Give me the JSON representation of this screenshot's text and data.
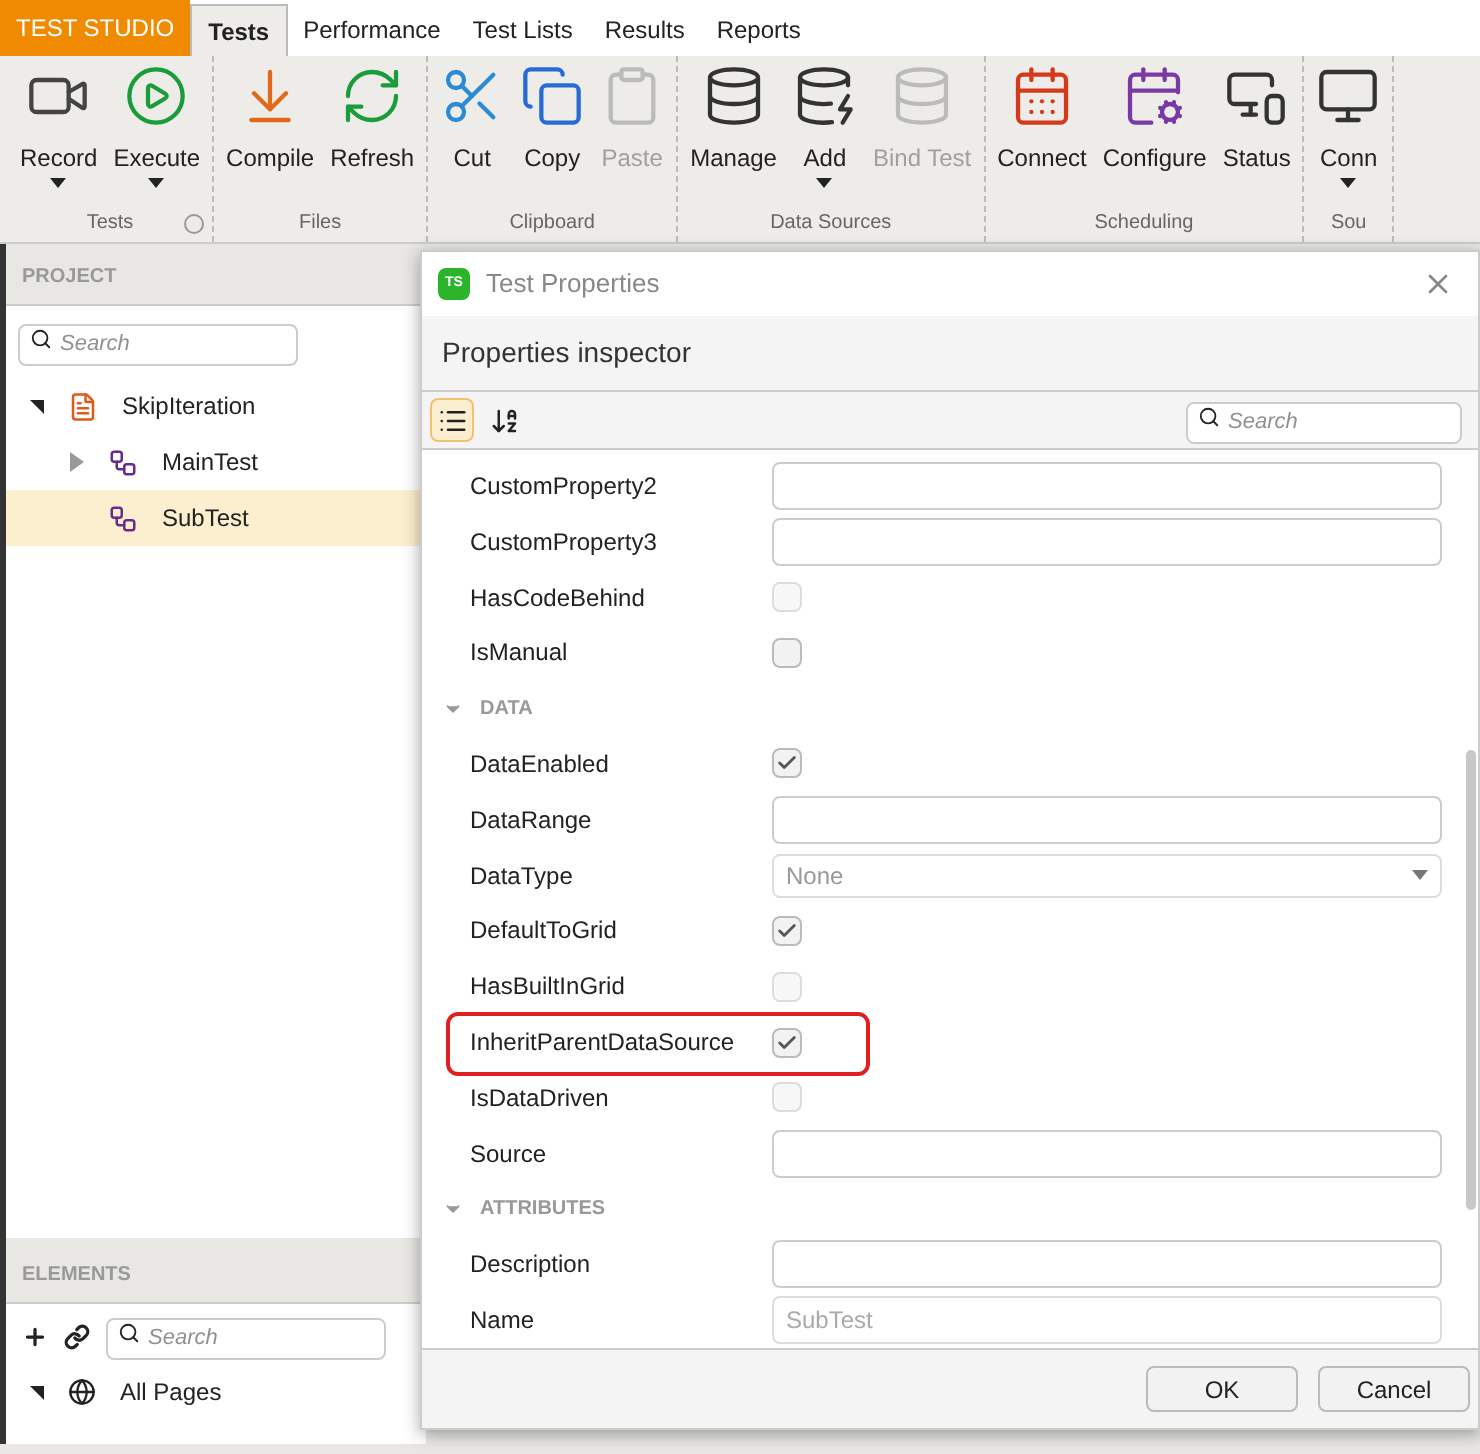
{
  "brand": "TEST STUDIO",
  "app_tabs": [
    {
      "label": "Tests",
      "selected": true
    },
    {
      "label": "Performance",
      "selected": false
    },
    {
      "label": "Test Lists",
      "selected": false
    },
    {
      "label": "Results",
      "selected": false
    },
    {
      "label": "Reports",
      "selected": false
    }
  ],
  "ribbon_groups": [
    {
      "label": "Tests",
      "launcher": true,
      "buttons": [
        {
          "label": "Record",
          "dropdown": true,
          "disabled": false
        },
        {
          "label": "Execute",
          "dropdown": true,
          "disabled": false
        }
      ]
    },
    {
      "label": "Files",
      "launcher": false,
      "buttons": [
        {
          "label": "Compile",
          "dropdown": false,
          "disabled": false
        },
        {
          "label": "Refresh",
          "dropdown": false,
          "disabled": false
        }
      ]
    },
    {
      "label": "Clipboard",
      "launcher": false,
      "buttons": [
        {
          "label": "Cut",
          "dropdown": false,
          "disabled": false
        },
        {
          "label": "Copy",
          "dropdown": false,
          "disabled": false
        },
        {
          "label": "Paste",
          "dropdown": false,
          "disabled": true
        }
      ]
    },
    {
      "label": "Data Sources",
      "launcher": false,
      "buttons": [
        {
          "label": "Manage",
          "dropdown": false,
          "disabled": false
        },
        {
          "label": "Add",
          "dropdown": true,
          "disabled": false
        },
        {
          "label": "Bind Test",
          "dropdown": false,
          "disabled": true
        }
      ]
    },
    {
      "label": "Scheduling",
      "launcher": false,
      "buttons": [
        {
          "label": "Connect",
          "dropdown": false,
          "disabled": false
        },
        {
          "label": "Configure",
          "dropdown": false,
          "disabled": false
        },
        {
          "label": "Status",
          "dropdown": false,
          "disabled": false
        }
      ]
    },
    {
      "label": "Sou",
      "launcher": false,
      "buttons": [
        {
          "label": "Conn",
          "dropdown": true,
          "disabled": false
        }
      ]
    }
  ],
  "project": {
    "title": "PROJECT",
    "search_placeholder": "Search",
    "tree": [
      {
        "label": "SkipIteration",
        "expanded": true,
        "selected": false,
        "children": [
          {
            "label": "MainTest",
            "expanded": false,
            "selected": false
          },
          {
            "label": "SubTest",
            "selected": true
          }
        ]
      }
    ]
  },
  "elements": {
    "title": "ELEMENTS",
    "search_placeholder": "Search",
    "tree": [
      {
        "label": "All Pages",
        "expanded": true
      }
    ]
  },
  "dialog": {
    "title": "Test Properties",
    "logo": "TS",
    "header": "Properties inspector",
    "search_placeholder": "Search",
    "view_buttons": [
      {
        "kind": "categorized",
        "selected": true
      },
      {
        "kind": "alphabetical",
        "selected": false
      }
    ],
    "rows": [
      {
        "kind": "text",
        "label": "CustomProperty2",
        "disabled": false
      },
      {
        "kind": "text",
        "label": "CustomProperty3",
        "disabled": false
      },
      {
        "kind": "checkbox",
        "label": "HasCodeBehind",
        "checked": false,
        "disabled": true,
        "highlighted": false
      },
      {
        "kind": "checkbox",
        "label": "IsManual",
        "checked": false,
        "disabled": false,
        "highlighted": false
      },
      {
        "kind": "header",
        "label": "DATA"
      },
      {
        "kind": "checkbox",
        "label": "DataEnabled",
        "checked": true,
        "disabled": false,
        "highlighted": false
      },
      {
        "kind": "text",
        "label": "DataRange",
        "disabled": false
      },
      {
        "kind": "dropdown",
        "label": "DataType",
        "value": "None",
        "disabled": true
      },
      {
        "kind": "checkbox",
        "label": "DefaultToGrid",
        "checked": true,
        "disabled": false,
        "highlighted": false
      },
      {
        "kind": "checkbox",
        "label": "HasBuiltInGrid",
        "checked": false,
        "disabled": true,
        "highlighted": false
      },
      {
        "kind": "checkbox",
        "label": "InheritParentDataSource",
        "checked": true,
        "disabled": false,
        "highlighted": true
      },
      {
        "kind": "checkbox",
        "label": "IsDataDriven",
        "checked": false,
        "disabled": true,
        "highlighted": false
      },
      {
        "kind": "text",
        "label": "Source",
        "disabled": false
      },
      {
        "kind": "header",
        "label": "ATTRIBUTES"
      },
      {
        "kind": "text",
        "label": "Description",
        "disabled": false
      },
      {
        "kind": "text",
        "label": "Name",
        "value": "SubTest",
        "disabled": true
      }
    ],
    "buttons": [
      "OK",
      "Cancel"
    ]
  }
}
